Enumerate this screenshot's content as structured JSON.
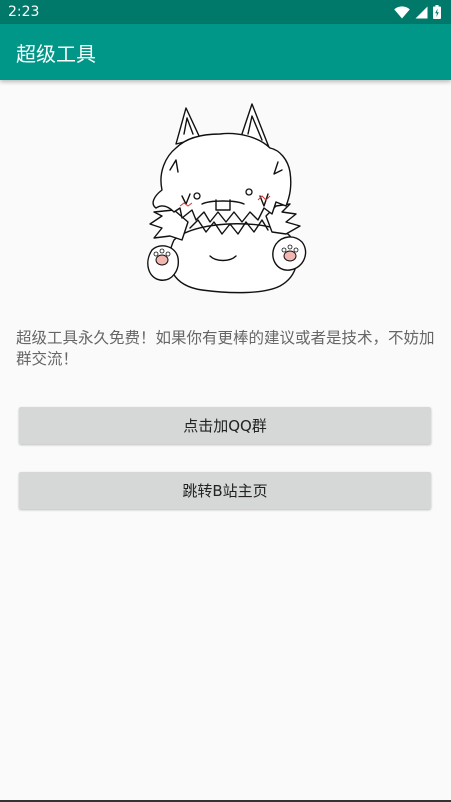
{
  "status_bar": {
    "time": "2:23",
    "icons": [
      "wifi-icon",
      "cellular-signal-icon",
      "battery-icon"
    ]
  },
  "app_bar": {
    "title": "超级工具"
  },
  "main": {
    "intro_text": "超级工具永久免费！如果你有更棒的建议或者是技术，不妨加群交流！",
    "buttons": {
      "join_qq_group": "点击加QQ群",
      "bilibili_home": "跳转B站主页"
    }
  },
  "colors": {
    "primary": "#009688",
    "primary_dark": "#00796b",
    "button": "#d6d7d7",
    "background": "#fafafa"
  }
}
